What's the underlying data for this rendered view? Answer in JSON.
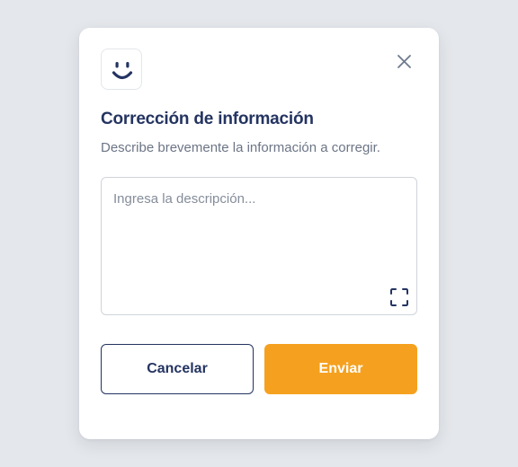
{
  "dialog": {
    "title": "Corrección de información",
    "subtitle": "Describe brevemente la información a corregir.",
    "description_field": {
      "value": "",
      "placeholder": "Ingresa la descripción..."
    },
    "buttons": {
      "cancel_label": "Cancelar",
      "send_label": "Enviar"
    },
    "icons": {
      "brand": "smiley-icon",
      "close": "close-icon",
      "expand": "expand-icon"
    }
  },
  "colors": {
    "backdrop": "#e4e7eb",
    "title": "#243461",
    "subtitle": "#6c7586",
    "primary": "#f5a11f",
    "secondary_border": "#243461"
  }
}
